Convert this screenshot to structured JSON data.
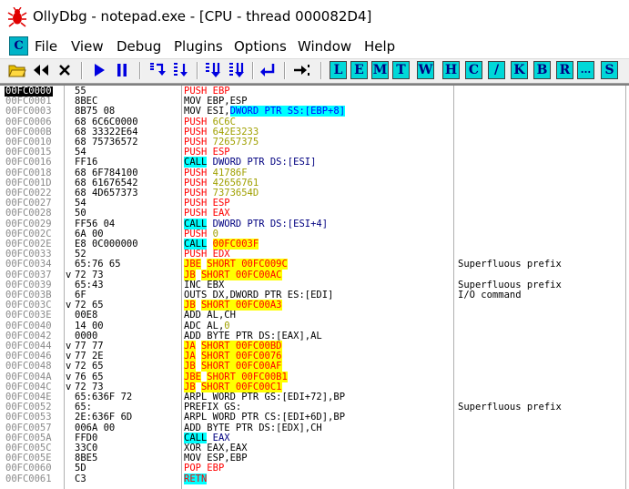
{
  "window": {
    "title": "OllyDbg - notepad.exe - [CPU - thread 000082D4]"
  },
  "menu": [
    "File",
    "View",
    "Debug",
    "Plugins",
    "Options",
    "Window",
    "Help"
  ],
  "mdi_icon_letter": "C",
  "toolbar": {
    "letter_buttons": [
      "L",
      "E",
      "M",
      "T",
      "W",
      "H",
      "C",
      "/",
      "K",
      "B",
      "R",
      "...",
      "S"
    ]
  },
  "colors": {
    "call_highlight": "#00ffff",
    "jump_highlight": "#ffff00",
    "push_text": "#ff0000",
    "immediate_text": "#a0a000",
    "address_text": "#8a8a8a",
    "letter_button_bg": "#00d8d8"
  },
  "rows": [
    {
      "addr": "00FC0000",
      "arrow": "",
      "hex": "55",
      "kind": "push",
      "op": "PUSH",
      "arg": "EBP",
      "cmt": "",
      "selected": true
    },
    {
      "addr": "00FC0001",
      "arrow": "",
      "hex": "8BEC",
      "kind": "plain",
      "op": "MOV",
      "arg": "EBP,ESP",
      "cmt": ""
    },
    {
      "addr": "00FC0003",
      "arrow": "",
      "hex": "8B75 08",
      "kind": "ptr",
      "op": "MOV",
      "arg": "ESI,",
      "arg2": "DWORD PTR SS:[EBP+8]",
      "cmt": ""
    },
    {
      "addr": "00FC0006",
      "arrow": "",
      "hex": "68 6C6C0000",
      "kind": "pushimm",
      "op": "PUSH",
      "arg": "6C6C",
      "cmt": ""
    },
    {
      "addr": "00FC000B",
      "arrow": "",
      "hex": "68 33322E64",
      "kind": "pushimm",
      "op": "PUSH",
      "arg": "642E3233",
      "cmt": ""
    },
    {
      "addr": "00FC0010",
      "arrow": "",
      "hex": "68 75736572",
      "kind": "pushimm",
      "op": "PUSH",
      "arg": "72657375",
      "cmt": ""
    },
    {
      "addr": "00FC0015",
      "arrow": "",
      "hex": "54",
      "kind": "push",
      "op": "PUSH",
      "arg": "ESP",
      "cmt": ""
    },
    {
      "addr": "00FC0016",
      "arrow": "",
      "hex": "FF16",
      "kind": "call",
      "op": "CALL",
      "arg": "DWORD PTR DS:[ESI]",
      "cmt": ""
    },
    {
      "addr": "00FC0018",
      "arrow": "",
      "hex": "68 6F784100",
      "kind": "pushimm",
      "op": "PUSH",
      "arg": "41786F",
      "cmt": ""
    },
    {
      "addr": "00FC001D",
      "arrow": "",
      "hex": "68 61676542",
      "kind": "pushimm",
      "op": "PUSH",
      "arg": "42656761",
      "cmt": ""
    },
    {
      "addr": "00FC0022",
      "arrow": "",
      "hex": "68 4D657373",
      "kind": "pushimm",
      "op": "PUSH",
      "arg": "7373654D",
      "cmt": ""
    },
    {
      "addr": "00FC0027",
      "arrow": "",
      "hex": "54",
      "kind": "push",
      "op": "PUSH",
      "arg": "ESP",
      "cmt": ""
    },
    {
      "addr": "00FC0028",
      "arrow": "",
      "hex": "50",
      "kind": "push",
      "op": "PUSH",
      "arg": "EAX",
      "cmt": ""
    },
    {
      "addr": "00FC0029",
      "arrow": "",
      "hex": "FF56 04",
      "kind": "call",
      "op": "CALL",
      "arg": "DWORD PTR DS:[ESI+4]",
      "cmt": ""
    },
    {
      "addr": "00FC002C",
      "arrow": "",
      "hex": "6A 00",
      "kind": "pushimm",
      "op": "PUSH",
      "arg": "0",
      "cmt": ""
    },
    {
      "addr": "00FC002E",
      "arrow": "",
      "hex": "E8 0C000000",
      "kind": "callimm",
      "op": "CALL",
      "arg": "00FC003F",
      "cmt": ""
    },
    {
      "addr": "00FC0033",
      "arrow": "",
      "hex": "52",
      "kind": "push",
      "op": "PUSH",
      "arg": "EDX",
      "cmt": ""
    },
    {
      "addr": "00FC0034",
      "arrow": "",
      "hex": "65:76 65",
      "kind": "jmp",
      "op": "JBE",
      "arg": "SHORT 00FC009C",
      "cmt": "Superfluous prefix"
    },
    {
      "addr": "00FC0037",
      "arrow": "v",
      "hex": "72 73",
      "kind": "jmp",
      "op": "JB",
      "arg": "SHORT 00FC00AC",
      "cmt": ""
    },
    {
      "addr": "00FC0039",
      "arrow": "",
      "hex": "65:43",
      "kind": "plain",
      "op": "INC",
      "arg": "EBX",
      "cmt": "Superfluous prefix"
    },
    {
      "addr": "00FC003B",
      "arrow": "",
      "hex": "6F",
      "kind": "plain",
      "op": "OUTS",
      "arg": "DX,DWORD PTR ES:[EDI]",
      "cmt": "I/O command"
    },
    {
      "addr": "00FC003C",
      "arrow": "v",
      "hex": "72 65",
      "kind": "jmp",
      "op": "JB",
      "arg": "SHORT 00FC00A3",
      "cmt": ""
    },
    {
      "addr": "00FC003E",
      "arrow": "",
      "hex": "00E8",
      "kind": "plain",
      "op": "ADD",
      "arg": "AL,CH",
      "cmt": ""
    },
    {
      "addr": "00FC0040",
      "arrow": "",
      "hex": "14 00",
      "kind": "addimm",
      "op": "ADC",
      "arg": "AL,",
      "arg2": "0",
      "cmt": ""
    },
    {
      "addr": "00FC0042",
      "arrow": "",
      "hex": "0000",
      "kind": "plain",
      "op": "ADD",
      "arg": "BYTE PTR DS:[EAX],AL",
      "cmt": ""
    },
    {
      "addr": "00FC0044",
      "arrow": "v",
      "hex": "77 77",
      "kind": "jmp",
      "op": "JA",
      "arg": "SHORT 00FC00BD",
      "cmt": ""
    },
    {
      "addr": "00FC0046",
      "arrow": "v",
      "hex": "77 2E",
      "kind": "jmp",
      "op": "JA",
      "arg": "SHORT 00FC0076",
      "cmt": ""
    },
    {
      "addr": "00FC0048",
      "arrow": "v",
      "hex": "72 65",
      "kind": "jmp",
      "op": "JB",
      "arg": "SHORT 00FC00AF",
      "cmt": ""
    },
    {
      "addr": "00FC004A",
      "arrow": "v",
      "hex": "76 65",
      "kind": "jmp",
      "op": "JBE",
      "arg": "SHORT 00FC00B1",
      "cmt": ""
    },
    {
      "addr": "00FC004C",
      "arrow": "v",
      "hex": "72 73",
      "kind": "jmp",
      "op": "JB",
      "arg": "SHORT 00FC00C1",
      "cmt": ""
    },
    {
      "addr": "00FC004E",
      "arrow": "",
      "hex": "65:636F 72",
      "kind": "plain",
      "op": "ARPL",
      "arg": "WORD PTR GS:[EDI+72],BP",
      "cmt": ""
    },
    {
      "addr": "00FC0052",
      "arrow": "",
      "hex": "65:",
      "kind": "plain",
      "op": "PREFIX",
      "arg": "GS:",
      "cmt": "Superfluous prefix"
    },
    {
      "addr": "00FC0053",
      "arrow": "",
      "hex": "2E:636F 6D",
      "kind": "plain",
      "op": "ARPL",
      "arg": "WORD PTR CS:[EDI+6D],BP",
      "cmt": ""
    },
    {
      "addr": "00FC0057",
      "arrow": "",
      "hex": "006A 00",
      "kind": "plain",
      "op": "ADD",
      "arg": "BYTE PTR DS:[EDX],CH",
      "cmt": ""
    },
    {
      "addr": "00FC005A",
      "arrow": "",
      "hex": "FFD0",
      "kind": "call",
      "op": "CALL",
      "arg": "EAX",
      "cmt": ""
    },
    {
      "addr": "00FC005C",
      "arrow": "",
      "hex": "33C0",
      "kind": "plain",
      "op": "XOR",
      "arg": "EAX,EAX",
      "cmt": ""
    },
    {
      "addr": "00FC005E",
      "arrow": "",
      "hex": "8BE5",
      "kind": "plain",
      "op": "MOV",
      "arg": "ESP,EBP",
      "cmt": ""
    },
    {
      "addr": "00FC0060",
      "arrow": "",
      "hex": "5D",
      "kind": "push",
      "op": "POP",
      "arg": "EBP",
      "cmt": ""
    },
    {
      "addr": "00FC0061",
      "arrow": "",
      "hex": "C3",
      "kind": "ret",
      "op": "RETN",
      "arg": "",
      "cmt": ""
    }
  ]
}
